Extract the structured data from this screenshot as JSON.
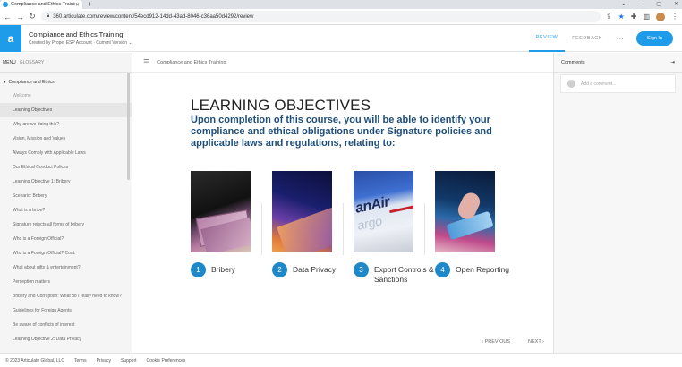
{
  "browser": {
    "tab_title": "Compliance and Ethics Training",
    "url": "360.articulate.com/review/content/54ecd912-14dd-43ad-8046-c36aa50d4292/review"
  },
  "header": {
    "logo_letter": "a",
    "course_title": "Compliance and Ethics Training",
    "created_by": "Created by Propel ESP Account",
    "version": "Current Version",
    "tab_review": "REVIEW",
    "tab_feedback": "FEEDBACK",
    "more": "···",
    "sign_in": "Sign In"
  },
  "sidebar": {
    "tab_menu": "MENU",
    "tab_glossary": "GLOSSARY",
    "section_title": "Compliance and Ethics",
    "lessons": [
      "Welcome",
      "Learning Objectives",
      "Why are we doing this?",
      "Vision, Mission and Values",
      "Always Comply with Applicable Laws",
      "Our Ethical Conduct Polices",
      "Learning Objective 1: Bribery",
      "Scenario: Bribery",
      "What is a bribe?",
      "Signature rejects all forms of bribery",
      "Who is a Foreign Official?",
      "Who is a Foreign Official? Cont.",
      "What about gifts & entertainment?",
      "Perception matters",
      "Bribery and Corruption: What do I really need to know?",
      "Guidelines for Foreign Agents",
      "Be aware of conflicts of interest",
      "Learning Objective 2: Data Privacy"
    ]
  },
  "content": {
    "breadcrumb": "Compliance and Ethics Training",
    "heading": "LEARNING OBJECTIVES",
    "intro": "Upon completion of this course, you will be able to identify your compliance and ethical obligations under Signature policies and applicable laws and regulations, relating to:",
    "objectives": [
      {
        "num": "1",
        "label": "Bribery"
      },
      {
        "num": "2",
        "label": "Data Privacy"
      },
      {
        "num": "3",
        "label": "Export Controls & Sanctions"
      },
      {
        "num": "4",
        "label": "Open Reporting"
      }
    ],
    "prev": "PREVIOUS",
    "next": "NEXT"
  },
  "comments": {
    "title": "Comments",
    "placeholder": "Add a comment..."
  },
  "footer": {
    "copyright": "© 2023 Articulate Global, LLC",
    "terms": "Terms",
    "privacy": "Privacy",
    "support": "Support",
    "cookies": "Cookie Preferences"
  },
  "colors": {
    "accent": "#1e9be9",
    "heading_blue": "#1f4e79",
    "badge_blue": "#1e88c8"
  }
}
